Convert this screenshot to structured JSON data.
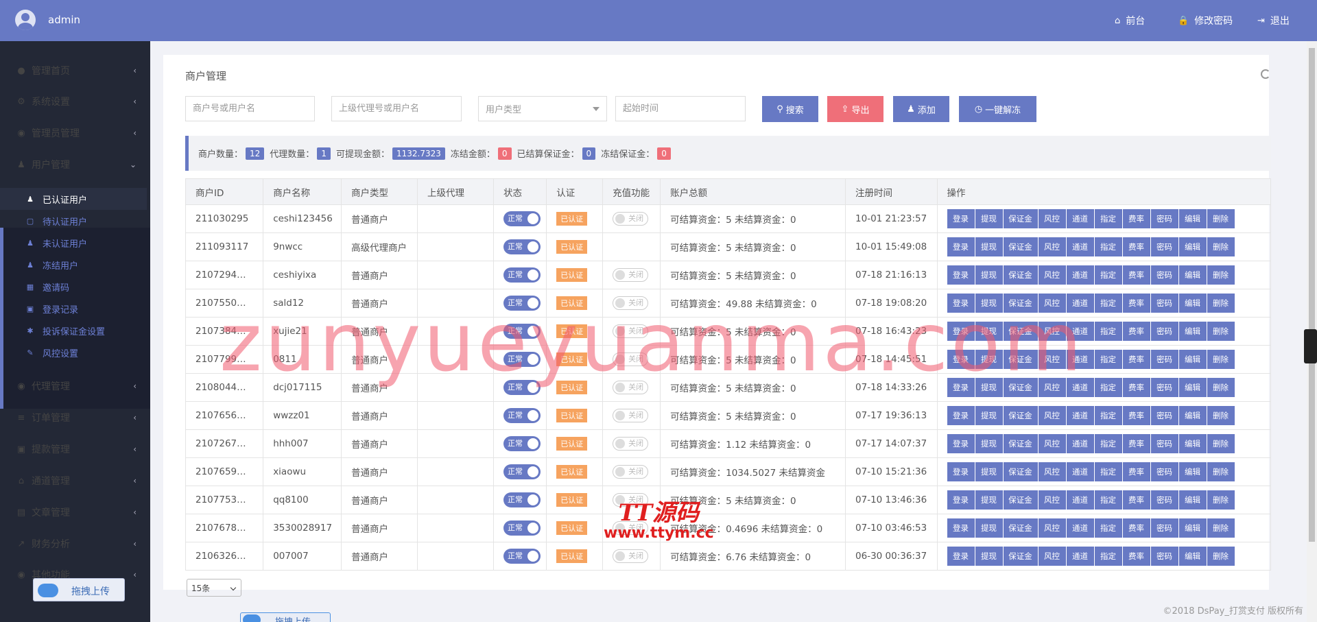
{
  "header": {
    "username": "admin",
    "links": [
      {
        "icon": "home-icon",
        "glyph": "⌂",
        "label": "前台"
      },
      {
        "icon": "lock-icon",
        "glyph": "🔒",
        "label": "修改密码"
      },
      {
        "icon": "logout-icon",
        "glyph": "⇥",
        "label": "退出"
      }
    ]
  },
  "sidebar": {
    "items": [
      {
        "icon": "dashboard-icon",
        "glyph": "●",
        "label": "管理首页"
      },
      {
        "icon": "cogs-icon",
        "glyph": "⚙",
        "label": "系统设置"
      },
      {
        "icon": "user-circle-icon",
        "glyph": "◉",
        "label": "管理员管理"
      },
      {
        "icon": "users-icon",
        "glyph": "♟",
        "label": "用户管理",
        "expanded": true
      },
      {
        "icon": "user-circle-icon",
        "glyph": "◉",
        "label": "代理管理"
      },
      {
        "icon": "list-icon",
        "glyph": "≡",
        "label": "订单管理"
      },
      {
        "icon": "lock-icon",
        "glyph": "▣",
        "label": "提款管理"
      },
      {
        "icon": "bank-icon",
        "glyph": "⌂",
        "label": "通道管理"
      },
      {
        "icon": "book-icon",
        "glyph": "▤",
        "label": "文章管理"
      },
      {
        "icon": "chart-icon",
        "glyph": "↗",
        "label": "财务分析"
      },
      {
        "icon": "user-circle-icon",
        "glyph": "◉",
        "label": "其他功能"
      }
    ],
    "subitems": [
      {
        "icon": "user-icon",
        "glyph": "♟",
        "label": "已认证用户",
        "active": true
      },
      {
        "icon": "lock-icon",
        "glyph": "▢",
        "label": "待认证用户"
      },
      {
        "icon": "user-plus-icon",
        "glyph": "♟",
        "label": "未认证用户"
      },
      {
        "icon": "user-times-icon",
        "glyph": "♟",
        "label": "冻结用户"
      },
      {
        "icon": "gift-icon",
        "glyph": "▦",
        "label": "邀请码"
      },
      {
        "icon": "id-card-icon",
        "glyph": "▣",
        "label": "登录记录"
      },
      {
        "icon": "gear-icon",
        "glyph": "✱",
        "label": "投诉保证金设置"
      },
      {
        "icon": "wrench-icon",
        "glyph": "✎",
        "label": "风控设置"
      }
    ],
    "upload_label": "拖拽上传"
  },
  "panel": {
    "title": "商户管理",
    "filters": {
      "merchant_placeholder": "商户号或用户名",
      "agent_placeholder": "上级代理号或用户名",
      "type_placeholder": "用户类型",
      "start_placeholder": "起始时间"
    },
    "buttons": [
      {
        "label": "搜索",
        "glyph": "⚲",
        "color": "#6779c4"
      },
      {
        "label": "导出",
        "glyph": "⇪",
        "color": "#ef6f79"
      },
      {
        "label": "添加",
        "glyph": "♟",
        "color": "#6779c4"
      },
      {
        "label": "一键解冻",
        "glyph": "◷",
        "color": "#6779c4"
      }
    ],
    "stats": [
      {
        "label": "商户数量：",
        "value": "12",
        "color": "#6779c4"
      },
      {
        "label": "代理数量：",
        "value": "1",
        "color": "#6779c4"
      },
      {
        "label": "可提现金额：",
        "value": "1132.7323",
        "color": "#6779c4"
      },
      {
        "label": "冻结金额：",
        "value": "0",
        "color": "#ef6f79"
      },
      {
        "label": "已结算保证金：",
        "value": "0",
        "color": "#6779c4"
      },
      {
        "label": "冻结保证金：",
        "value": "0",
        "color": "#ef6f79"
      }
    ]
  },
  "table": {
    "columns": [
      "商户ID",
      "商户名称",
      "商户类型",
      "上级代理",
      "状态",
      "认证",
      "充值功能",
      "账户总额",
      "注册时间",
      "操作"
    ],
    "status_label": "正常",
    "cert_label": "已认证",
    "recharge_label": "关闭",
    "actions": [
      "登录",
      "提现",
      "保证金",
      "风控",
      "通道",
      "指定",
      "费率",
      "密码",
      "编辑",
      "删除"
    ],
    "rows": [
      {
        "id": "211030295",
        "name": "ceshi123456",
        "type": "普通商户",
        "recharge": true,
        "balance": "可结算资金：5 未结算资金：0",
        "time": "10-01 21:23:57"
      },
      {
        "id": "211093117",
        "name": "9nwcc",
        "type": "高级代理商户",
        "recharge": false,
        "balance": "可结算资金：5 未结算资金：0",
        "time": "10-01 15:49:08"
      },
      {
        "id": "2107294…",
        "name": "ceshiyixa",
        "type": "普通商户",
        "recharge": true,
        "balance": "可结算资金：5 未结算资金：0",
        "time": "07-18 21:16:13"
      },
      {
        "id": "2107550…",
        "name": "sald12",
        "type": "普通商户",
        "recharge": true,
        "balance": "可结算资金：49.88 未结算资金：0",
        "time": "07-18 19:08:20"
      },
      {
        "id": "2107384…",
        "name": "xujie21",
        "type": "普通商户",
        "recharge": true,
        "balance": "可结算资金：5 未结算资金：0",
        "time": "07-18 16:43:23"
      },
      {
        "id": "2107799…",
        "name": "0811",
        "type": "普通商户",
        "recharge": true,
        "balance": "可结算资金：5 未结算资金：0",
        "time": "07-18 14:45:51"
      },
      {
        "id": "2108044…",
        "name": "dcj017115",
        "type": "普通商户",
        "recharge": true,
        "balance": "可结算资金：5 未结算资金：0",
        "time": "07-18 14:33:26"
      },
      {
        "id": "2107656…",
        "name": "wwzz01",
        "type": "普通商户",
        "recharge": true,
        "balance": "可结算资金：5 未结算资金：0",
        "time": "07-17 19:36:13"
      },
      {
        "id": "2107267…",
        "name": "hhh007",
        "type": "普通商户",
        "recharge": true,
        "balance": "可结算资金：1.12 未结算资金：0",
        "time": "07-17 14:07:37"
      },
      {
        "id": "2107659…",
        "name": "xiaowu",
        "type": "普通商户",
        "recharge": true,
        "balance": "可结算资金：1034.5027 未结算资金",
        "time": "07-10 15:21:36"
      },
      {
        "id": "2107753…",
        "name": "qq8100",
        "type": "普通商户",
        "recharge": true,
        "balance": "可结算资金：5 未结算资金：0",
        "time": "07-10 13:46:36"
      },
      {
        "id": "2107678…",
        "name": "3530028917",
        "type": "普通商户",
        "recharge": true,
        "balance": "可结算资金：0.4696 未结算资金：0",
        "time": "07-10 03:46:53"
      },
      {
        "id": "2106326…",
        "name": "007007",
        "type": "普通商户",
        "recharge": true,
        "balance": "可结算资金：6.76 未结算资金：0",
        "time": "06-30 00:36:37"
      }
    ]
  },
  "pager": {
    "page_size": "15条"
  },
  "footer": {
    "copyright": "©2018 DsPay_打赏支付 版权所有"
  },
  "watermarks": {
    "main": "zunyueyuanma.com",
    "brand": "TT源码",
    "brand_url": "www.ttym.cc"
  }
}
